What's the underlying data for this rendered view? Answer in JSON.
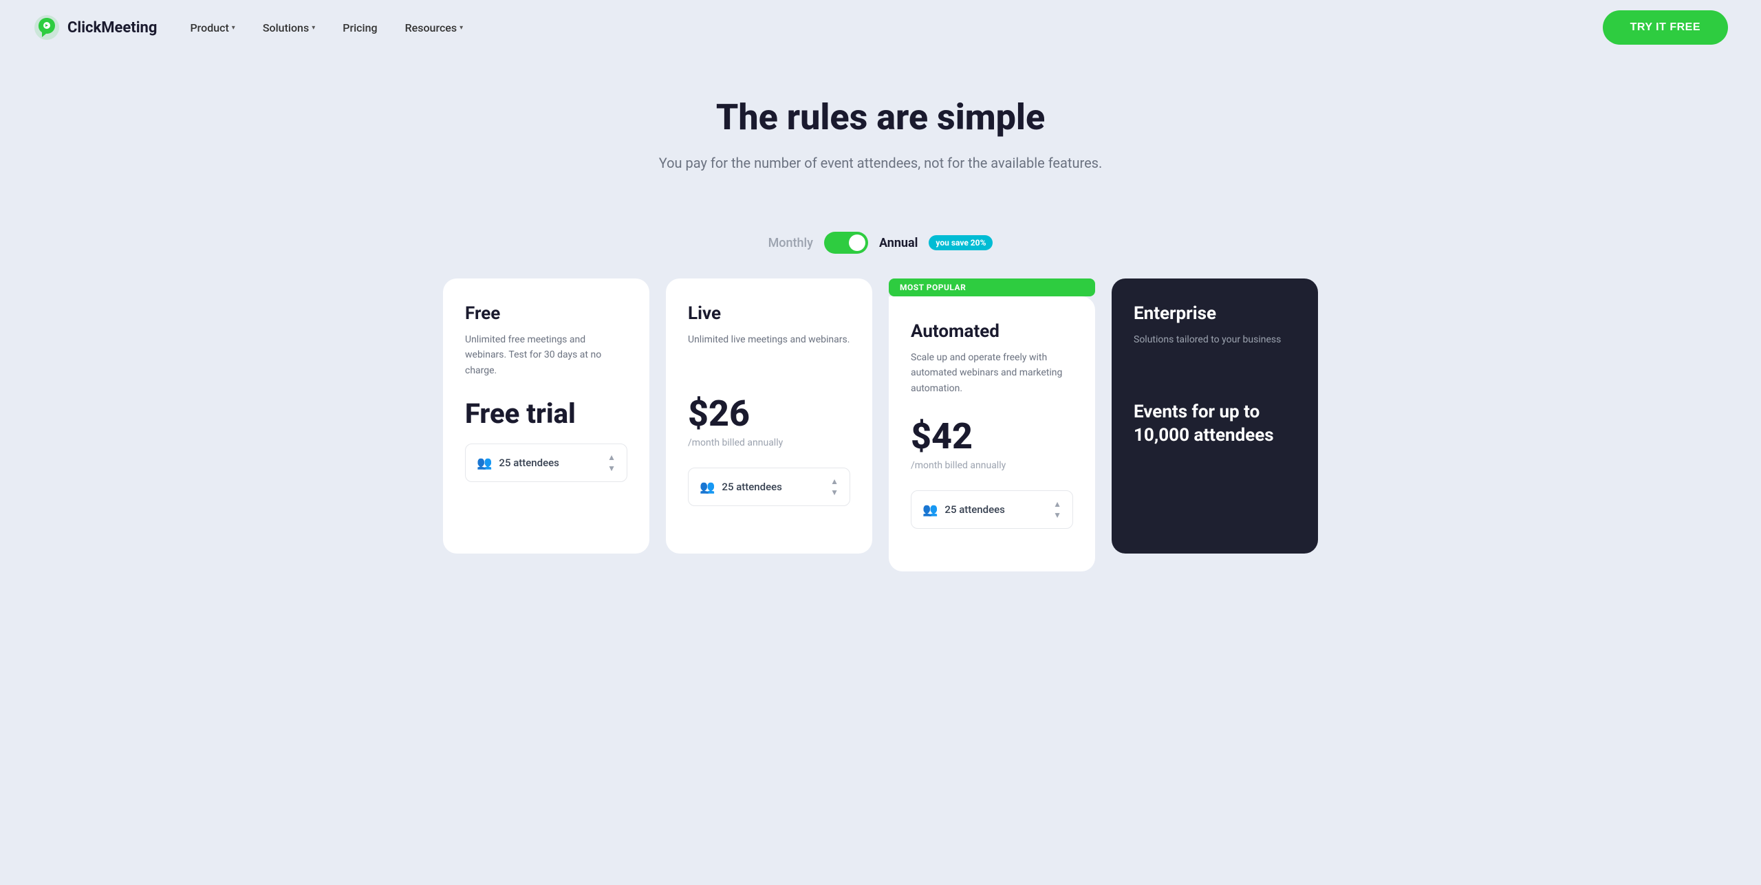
{
  "logo": {
    "text": "ClickMeeting"
  },
  "navbar": {
    "links": [
      {
        "label": "Product",
        "has_dropdown": true
      },
      {
        "label": "Solutions",
        "has_dropdown": true
      },
      {
        "label": "Pricing",
        "has_dropdown": false
      },
      {
        "label": "Resources",
        "has_dropdown": true
      }
    ],
    "cta_label": "TRY IT FREE"
  },
  "hero": {
    "title": "The rules are simple",
    "subtitle": "You pay for the number of event attendees, not for the available features."
  },
  "billing_toggle": {
    "monthly_label": "Monthly",
    "annual_label": "Annual",
    "save_badge": "you save 20%",
    "is_annual": true
  },
  "plans": [
    {
      "id": "free",
      "name": "Free",
      "description": "Unlimited free meetings and webinars. Test for 30 days at no charge.",
      "price": "Free trial",
      "billing": "",
      "attendees": "25 attendees",
      "is_popular": false,
      "is_enterprise": false
    },
    {
      "id": "live",
      "name": "Live",
      "description": "Unlimited live meetings and webinars.",
      "price": "$26",
      "billing": "/month billed annually",
      "attendees": "25 attendees",
      "is_popular": false,
      "is_enterprise": false
    },
    {
      "id": "automated",
      "name": "Automated",
      "description": "Scale up and operate freely with automated webinars and marketing automation.",
      "price": "$42",
      "billing": "/month billed annually",
      "attendees": "25 attendees",
      "is_popular": true,
      "popular_label": "MOST POPULAR",
      "is_enterprise": false
    },
    {
      "id": "enterprise",
      "name": "Enterprise",
      "description": "Solutions tailored to your business",
      "attendees_text": "Events for up to 10,000 attendees",
      "is_popular": false,
      "is_enterprise": true
    }
  ]
}
